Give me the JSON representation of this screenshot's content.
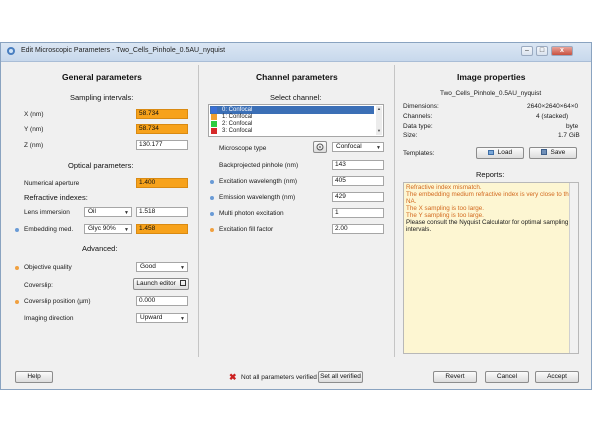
{
  "window": {
    "title": "Edit Microscopic Parameters - Two_Cells_Pinhole_0.5AU_nyquist",
    "minimize": "–",
    "maximize": "□",
    "close": "x"
  },
  "general": {
    "heading": "General parameters",
    "sampling_heading": "Sampling intervals:",
    "x_label": "X (nm)",
    "x_value": "58.734",
    "y_label": "Y (nm)",
    "y_value": "58.734",
    "z_label": "Z (nm)",
    "z_value": "130.177",
    "optical_heading": "Optical parameters:",
    "na_label": "Numerical aperture",
    "na_value": "1.400",
    "refr_heading": "Refractive indexes:",
    "lens_label": "Lens immersion",
    "lens_medium": "Oil",
    "lens_value": "1.518",
    "embed_label": "Embedding med.",
    "embed_medium": "Glyc 90%",
    "embed_value": "1.458",
    "advanced_heading": "Advanced:",
    "objective_label": "Objective quality",
    "objective_value": "Good",
    "coverslip_label": "Coverslip:",
    "coverslip_button": "Launch editor",
    "coverslip_pos_label": "Coverslip position (µm)",
    "coverslip_pos_value": "0.000",
    "imaging_label": "Imaging direction",
    "imaging_value": "Upward"
  },
  "channel": {
    "heading": "Channel parameters",
    "select_heading": "Select channel:",
    "channels": [
      {
        "label": "0: Confocal",
        "color": "#3b6fd6"
      },
      {
        "label": "1: Confocal",
        "color": "#f0a030"
      },
      {
        "label": "2: Confocal",
        "color": "#2ecc40"
      },
      {
        "label": "3: Confocal",
        "color": "#d62a2a"
      }
    ],
    "microscope_label": "Microscope type",
    "microscope_value": "Confocal",
    "pinhole_label": "Backprojected pinhole (nm)",
    "pinhole_value": "143",
    "excitation_label": "Excitation wavelength (nm)",
    "excitation_value": "405",
    "emission_label": "Emission wavelength (nm)",
    "emission_value": "429",
    "multiphoton_label": "Multi photon excitation",
    "multiphoton_value": "1",
    "fill_label": "Excitation fill factor",
    "fill_value": "2.00"
  },
  "image": {
    "heading": "Image properties",
    "filename": "Two_Cells_Pinhole_0.5AU_nyquist",
    "dimensions_label": "Dimensions:",
    "dimensions_value": "2640×2640×64×0",
    "channels_label": "Channels:",
    "channels_value": "4 (stacked)",
    "datatype_label": "Data type:",
    "datatype_value": "byte",
    "size_label": "Size:",
    "size_value": "1.7 GiB",
    "templates_label": "Templates:",
    "load_button": "Load",
    "save_button": "Save",
    "reports_heading": "Reports:",
    "reports": [
      {
        "text": "Refractive index mismatch.",
        "kind": "warn"
      },
      {
        "text": "The embedding medium refractive index is very close to the",
        "kind": "warn"
      },
      {
        "text": "NA.",
        "kind": "warn"
      },
      {
        "text": "The X sampling is too large.",
        "kind": "warn"
      },
      {
        "text": "The Y sampling is too large.",
        "kind": "warn"
      },
      {
        "text": "Please consult the Nyquist Calculator for optimal sampling",
        "kind": "info"
      },
      {
        "text": "intervals.",
        "kind": "info"
      }
    ]
  },
  "footer": {
    "help": "Help",
    "status": "Not all parameters verified",
    "set_verified": "Set all verified",
    "revert": "Revert",
    "cancel": "Cancel",
    "accept": "Accept"
  },
  "colors": {
    "warning_field": "#f7a21b",
    "report_warning_text": "#d2691e",
    "report_background": "#fdf6d2",
    "selected_channel": "#3b6fb6"
  }
}
